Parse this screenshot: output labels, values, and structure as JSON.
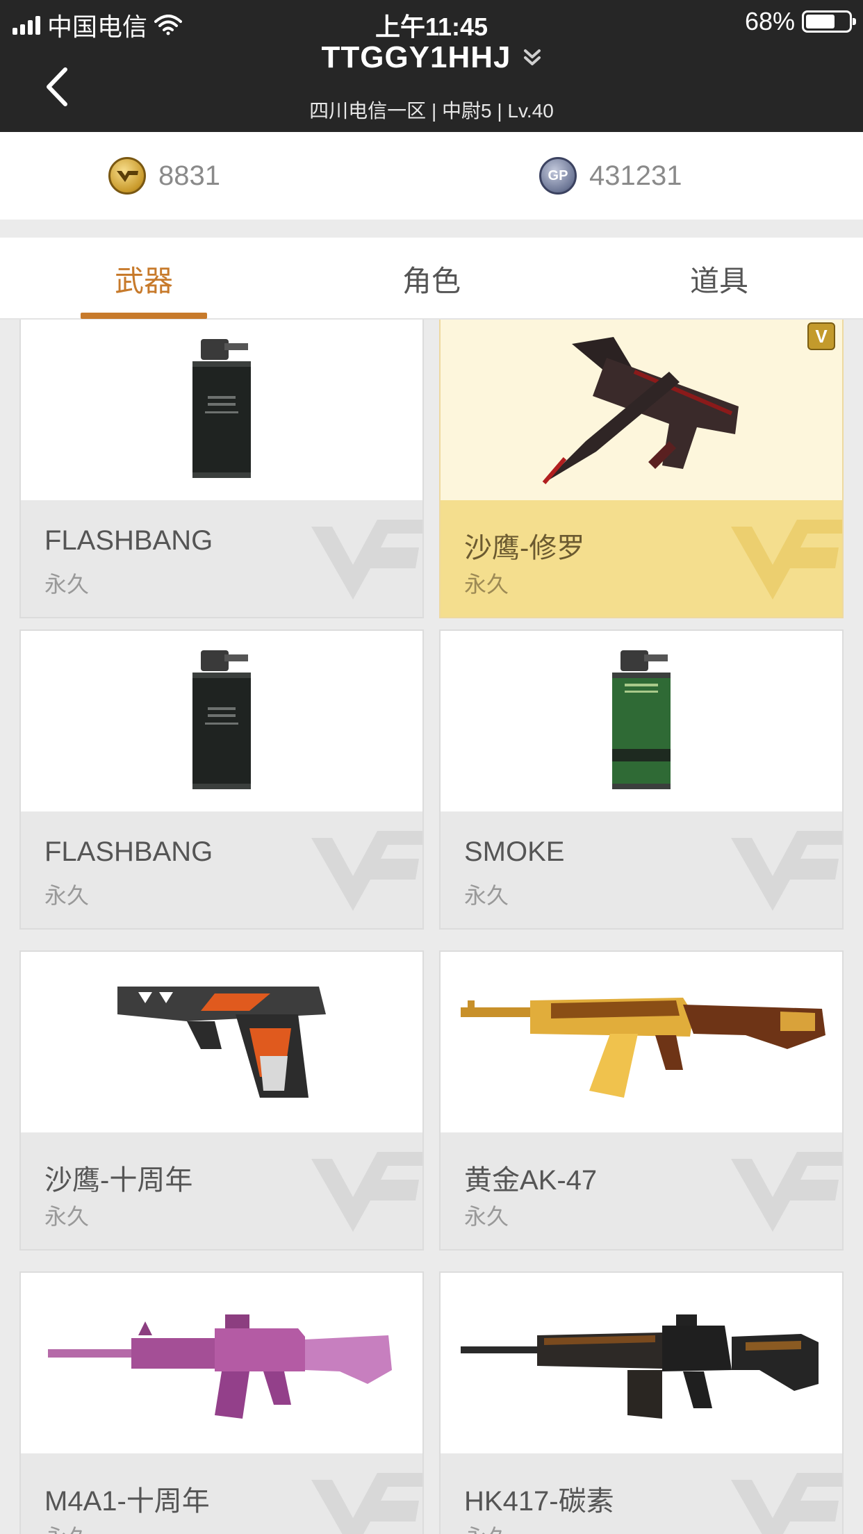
{
  "status": {
    "carrier": "中国电信",
    "time": "上午11:45",
    "battery_percent": "68%",
    "battery_level": 0.68
  },
  "header": {
    "title": "TTGGY1HHJ",
    "subtitle": "四川电信一区 | 中尉5 | Lv.40"
  },
  "currency": {
    "cf_points": "8831",
    "gp": "431231",
    "gp_badge": "GP"
  },
  "tabs": [
    {
      "label": "武器",
      "active": true
    },
    {
      "label": "角色",
      "active": false
    },
    {
      "label": "道具",
      "active": false
    }
  ],
  "items": [
    {
      "name": "FLASHBANG",
      "duration": "永久",
      "icon": "flashbang-grenade-icon",
      "highlight": false
    },
    {
      "name": "沙鹰-修罗",
      "duration": "永久",
      "icon": "desert-eagle-asura-icon",
      "highlight": true,
      "badge": "V"
    },
    {
      "name": "FLASHBANG",
      "duration": "永久",
      "icon": "flashbang-grenade-icon",
      "highlight": false
    },
    {
      "name": "SMOKE",
      "duration": "永久",
      "icon": "smoke-grenade-icon",
      "highlight": false
    },
    {
      "name": "沙鹰-十周年",
      "duration": "永久",
      "icon": "desert-eagle-anniversary-icon",
      "highlight": false
    },
    {
      "name": "黄金AK-47",
      "duration": "永久",
      "icon": "golden-ak47-icon",
      "highlight": false
    },
    {
      "name": "M4A1-十周年",
      "duration": "永久",
      "icon": "m4a1-anniversary-icon",
      "highlight": false
    },
    {
      "name": "HK417-碳素",
      "duration": "永久",
      "icon": "hk417-carbon-icon",
      "highlight": false
    }
  ],
  "colors": {
    "header_bg": "#262626",
    "accent": "#c77a2b",
    "highlight_card": "#f4de8e"
  }
}
